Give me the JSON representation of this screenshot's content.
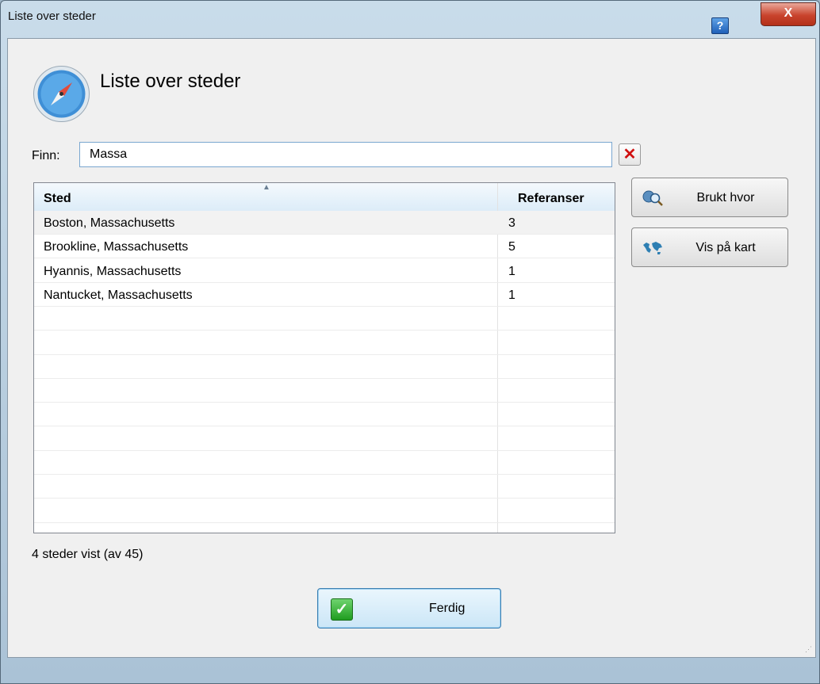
{
  "window": {
    "title": "Liste over steder",
    "help_label": "?",
    "close_label": "X"
  },
  "heading": "Liste over steder",
  "search": {
    "label": "Finn:",
    "value": "Massa",
    "clear_label": "✕"
  },
  "table": {
    "columns": {
      "place": "Sted",
      "refs": "Referanser"
    },
    "rows": [
      {
        "place": "Boston, Massachusetts",
        "refs": "3"
      },
      {
        "place": "Brookline, Massachusetts",
        "refs": "5"
      },
      {
        "place": "Hyannis, Massachusetts",
        "refs": "1"
      },
      {
        "place": "Nantucket, Massachusetts",
        "refs": "1"
      }
    ]
  },
  "buttons": {
    "used_where": "Brukt hvor",
    "show_on_map": "Vis på kart",
    "done": "Ferdig"
  },
  "status": "4 steder vist (av 45)",
  "icons": {
    "app": "compass-icon",
    "used_where": "magnifier-icon",
    "map": "world-map-icon",
    "done": "checkmark-icon"
  }
}
